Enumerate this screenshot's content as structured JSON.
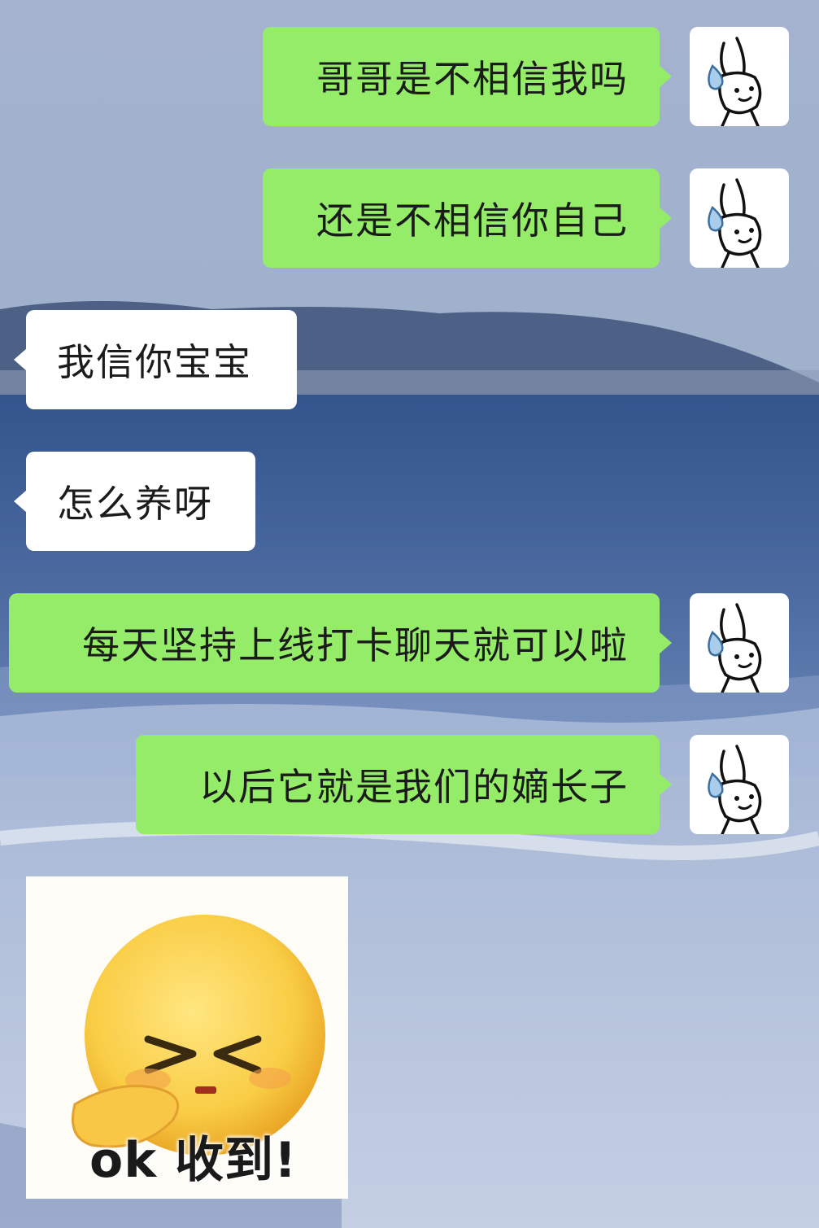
{
  "chat": {
    "messages": [
      {
        "side": "sent",
        "text": "哥哥是不相信我吗",
        "avatar": "rabbit-sweat-avatar"
      },
      {
        "side": "sent",
        "text": "还是不相信你自己",
        "avatar": "rabbit-sweat-avatar"
      },
      {
        "side": "received",
        "text": "我信你宝宝"
      },
      {
        "side": "received",
        "text": "怎么养呀"
      },
      {
        "side": "sent",
        "text": "每天坚持上线打卡聊天就可以啦",
        "avatar": "rabbit-sweat-avatar"
      },
      {
        "side": "sent",
        "text": "以后它就是我们的嫡长子",
        "avatar": "rabbit-sweat-avatar"
      }
    ],
    "sticker": {
      "text": "ok 收到!",
      "icon": "emoji-squint-face-sticker"
    }
  },
  "colors": {
    "sent_bubble": "#95ec69",
    "received_bubble": "#ffffff",
    "background_sky": "#8fa4c4",
    "background_sea": "#3e5e93"
  }
}
